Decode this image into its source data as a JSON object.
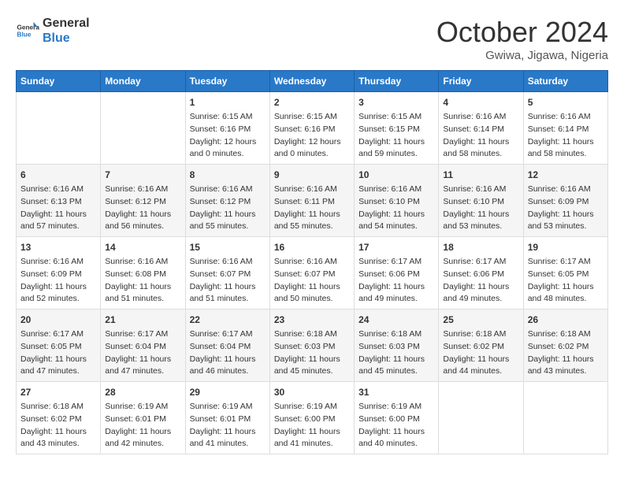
{
  "header": {
    "logo_general": "General",
    "logo_blue": "Blue",
    "month_title": "October 2024",
    "location": "Gwiwa, Jigawa, Nigeria"
  },
  "weekdays": [
    "Sunday",
    "Monday",
    "Tuesday",
    "Wednesday",
    "Thursday",
    "Friday",
    "Saturday"
  ],
  "weeks": [
    [
      {
        "day": "",
        "sunrise": "",
        "sunset": "",
        "daylight": ""
      },
      {
        "day": "",
        "sunrise": "",
        "sunset": "",
        "daylight": ""
      },
      {
        "day": "1",
        "sunrise": "Sunrise: 6:15 AM",
        "sunset": "Sunset: 6:16 PM",
        "daylight": "Daylight: 12 hours and 0 minutes."
      },
      {
        "day": "2",
        "sunrise": "Sunrise: 6:15 AM",
        "sunset": "Sunset: 6:16 PM",
        "daylight": "Daylight: 12 hours and 0 minutes."
      },
      {
        "day": "3",
        "sunrise": "Sunrise: 6:15 AM",
        "sunset": "Sunset: 6:15 PM",
        "daylight": "Daylight: 11 hours and 59 minutes."
      },
      {
        "day": "4",
        "sunrise": "Sunrise: 6:16 AM",
        "sunset": "Sunset: 6:14 PM",
        "daylight": "Daylight: 11 hours and 58 minutes."
      },
      {
        "day": "5",
        "sunrise": "Sunrise: 6:16 AM",
        "sunset": "Sunset: 6:14 PM",
        "daylight": "Daylight: 11 hours and 58 minutes."
      }
    ],
    [
      {
        "day": "6",
        "sunrise": "Sunrise: 6:16 AM",
        "sunset": "Sunset: 6:13 PM",
        "daylight": "Daylight: 11 hours and 57 minutes."
      },
      {
        "day": "7",
        "sunrise": "Sunrise: 6:16 AM",
        "sunset": "Sunset: 6:12 PM",
        "daylight": "Daylight: 11 hours and 56 minutes."
      },
      {
        "day": "8",
        "sunrise": "Sunrise: 6:16 AM",
        "sunset": "Sunset: 6:12 PM",
        "daylight": "Daylight: 11 hours and 55 minutes."
      },
      {
        "day": "9",
        "sunrise": "Sunrise: 6:16 AM",
        "sunset": "Sunset: 6:11 PM",
        "daylight": "Daylight: 11 hours and 55 minutes."
      },
      {
        "day": "10",
        "sunrise": "Sunrise: 6:16 AM",
        "sunset": "Sunset: 6:10 PM",
        "daylight": "Daylight: 11 hours and 54 minutes."
      },
      {
        "day": "11",
        "sunrise": "Sunrise: 6:16 AM",
        "sunset": "Sunset: 6:10 PM",
        "daylight": "Daylight: 11 hours and 53 minutes."
      },
      {
        "day": "12",
        "sunrise": "Sunrise: 6:16 AM",
        "sunset": "Sunset: 6:09 PM",
        "daylight": "Daylight: 11 hours and 53 minutes."
      }
    ],
    [
      {
        "day": "13",
        "sunrise": "Sunrise: 6:16 AM",
        "sunset": "Sunset: 6:09 PM",
        "daylight": "Daylight: 11 hours and 52 minutes."
      },
      {
        "day": "14",
        "sunrise": "Sunrise: 6:16 AM",
        "sunset": "Sunset: 6:08 PM",
        "daylight": "Daylight: 11 hours and 51 minutes."
      },
      {
        "day": "15",
        "sunrise": "Sunrise: 6:16 AM",
        "sunset": "Sunset: 6:07 PM",
        "daylight": "Daylight: 11 hours and 51 minutes."
      },
      {
        "day": "16",
        "sunrise": "Sunrise: 6:16 AM",
        "sunset": "Sunset: 6:07 PM",
        "daylight": "Daylight: 11 hours and 50 minutes."
      },
      {
        "day": "17",
        "sunrise": "Sunrise: 6:17 AM",
        "sunset": "Sunset: 6:06 PM",
        "daylight": "Daylight: 11 hours and 49 minutes."
      },
      {
        "day": "18",
        "sunrise": "Sunrise: 6:17 AM",
        "sunset": "Sunset: 6:06 PM",
        "daylight": "Daylight: 11 hours and 49 minutes."
      },
      {
        "day": "19",
        "sunrise": "Sunrise: 6:17 AM",
        "sunset": "Sunset: 6:05 PM",
        "daylight": "Daylight: 11 hours and 48 minutes."
      }
    ],
    [
      {
        "day": "20",
        "sunrise": "Sunrise: 6:17 AM",
        "sunset": "Sunset: 6:05 PM",
        "daylight": "Daylight: 11 hours and 47 minutes."
      },
      {
        "day": "21",
        "sunrise": "Sunrise: 6:17 AM",
        "sunset": "Sunset: 6:04 PM",
        "daylight": "Daylight: 11 hours and 47 minutes."
      },
      {
        "day": "22",
        "sunrise": "Sunrise: 6:17 AM",
        "sunset": "Sunset: 6:04 PM",
        "daylight": "Daylight: 11 hours and 46 minutes."
      },
      {
        "day": "23",
        "sunrise": "Sunrise: 6:18 AM",
        "sunset": "Sunset: 6:03 PM",
        "daylight": "Daylight: 11 hours and 45 minutes."
      },
      {
        "day": "24",
        "sunrise": "Sunrise: 6:18 AM",
        "sunset": "Sunset: 6:03 PM",
        "daylight": "Daylight: 11 hours and 45 minutes."
      },
      {
        "day": "25",
        "sunrise": "Sunrise: 6:18 AM",
        "sunset": "Sunset: 6:02 PM",
        "daylight": "Daylight: 11 hours and 44 minutes."
      },
      {
        "day": "26",
        "sunrise": "Sunrise: 6:18 AM",
        "sunset": "Sunset: 6:02 PM",
        "daylight": "Daylight: 11 hours and 43 minutes."
      }
    ],
    [
      {
        "day": "27",
        "sunrise": "Sunrise: 6:18 AM",
        "sunset": "Sunset: 6:02 PM",
        "daylight": "Daylight: 11 hours and 43 minutes."
      },
      {
        "day": "28",
        "sunrise": "Sunrise: 6:19 AM",
        "sunset": "Sunset: 6:01 PM",
        "daylight": "Daylight: 11 hours and 42 minutes."
      },
      {
        "day": "29",
        "sunrise": "Sunrise: 6:19 AM",
        "sunset": "Sunset: 6:01 PM",
        "daylight": "Daylight: 11 hours and 41 minutes."
      },
      {
        "day": "30",
        "sunrise": "Sunrise: 6:19 AM",
        "sunset": "Sunset: 6:00 PM",
        "daylight": "Daylight: 11 hours and 41 minutes."
      },
      {
        "day": "31",
        "sunrise": "Sunrise: 6:19 AM",
        "sunset": "Sunset: 6:00 PM",
        "daylight": "Daylight: 11 hours and 40 minutes."
      },
      {
        "day": "",
        "sunrise": "",
        "sunset": "",
        "daylight": ""
      },
      {
        "day": "",
        "sunrise": "",
        "sunset": "",
        "daylight": ""
      }
    ]
  ]
}
